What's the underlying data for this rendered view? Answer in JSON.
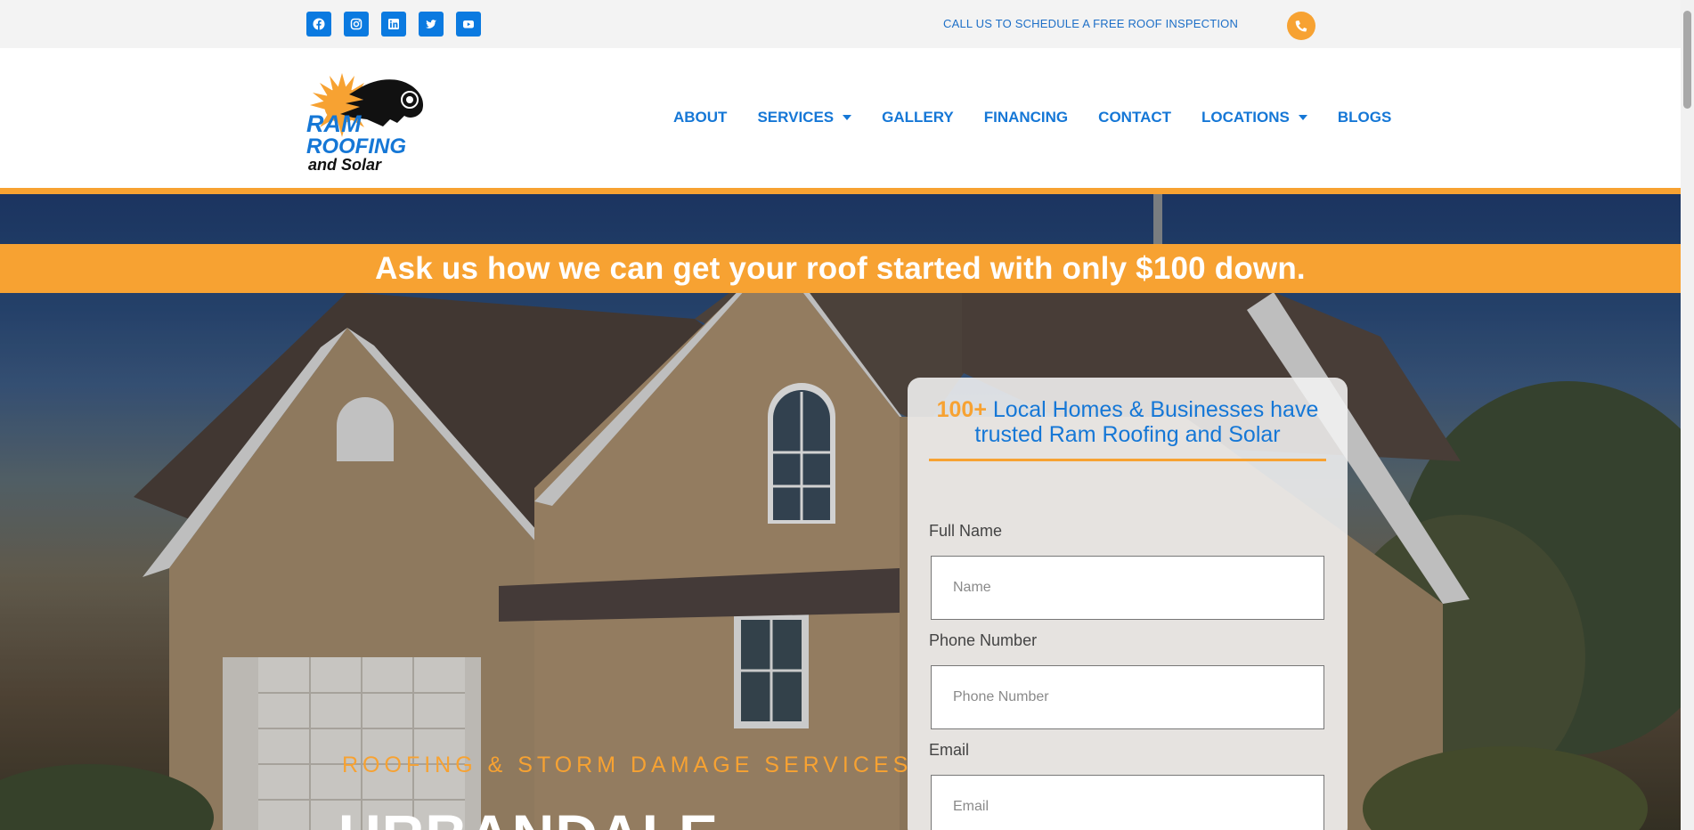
{
  "topbar": {
    "social": [
      "facebook-icon",
      "instagram-icon",
      "linkedin-icon",
      "twitter-icon",
      "youtube-icon"
    ],
    "cta": "CALL US TO SCHEDULE A FREE ROOF INSPECTION",
    "phone_icon": "phone-icon"
  },
  "header": {
    "logo": {
      "line1": "RAM",
      "line2": "ROOFING",
      "line3": "and Solar"
    },
    "nav": {
      "about": "ABOUT",
      "services": "SERVICES",
      "gallery": "GALLERY",
      "financing": "FINANCING",
      "contact": "CONTACT",
      "locations": "LOCATIONS",
      "blogs": "BLOGS"
    }
  },
  "hero": {
    "promo": "Ask us how we can get your roof started with only $100 down.",
    "eyebrow": "ROOFING & STORM DAMAGE SERVICES",
    "city": "URBANDALE"
  },
  "form": {
    "title_highlight": "100+",
    "title_rest": " Local Homes & Businesses have trusted Ram Roofing and Solar",
    "name_label": "Full Name",
    "name_placeholder": "Name",
    "phone_label": "Phone Number",
    "phone_placeholder": "Phone Number",
    "email_label": "Email",
    "email_placeholder": "Email"
  },
  "colors": {
    "brand_blue": "#1577d6",
    "brand_orange": "#f7a232",
    "social_blue": "#0b7ae0"
  }
}
